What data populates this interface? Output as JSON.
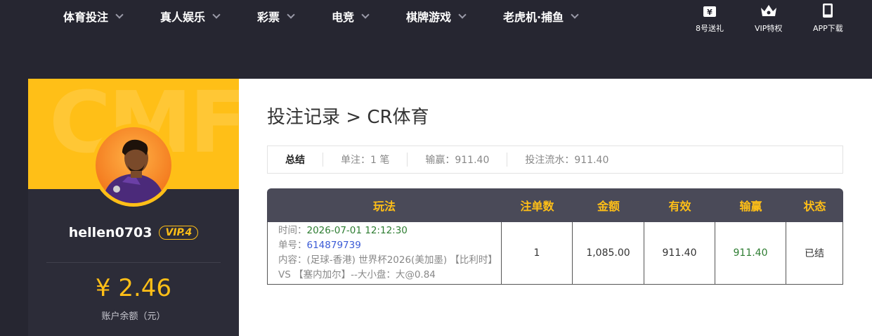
{
  "nav": {
    "items": [
      {
        "label": "体育投注"
      },
      {
        "label": "真人娱乐"
      },
      {
        "label": "彩票"
      },
      {
        "label": "电竞"
      },
      {
        "label": "棋牌游戏"
      },
      {
        "label": "老虎机·捕鱼"
      }
    ],
    "quick_links": [
      {
        "label": "8号送礼",
        "icon": "gift-ticket-icon"
      },
      {
        "label": "VIP特权",
        "icon": "crown-icon"
      },
      {
        "label": "APP下载",
        "icon": "phone-icon"
      }
    ]
  },
  "sidebar": {
    "watermark": "CMF",
    "username": "hellen0703",
    "vip": "VIP.4",
    "balance": "¥ 2.46",
    "balance_label": "账户余额（元）"
  },
  "main": {
    "breadcrumb": "投注记录 > CR体育",
    "summary": {
      "title": "总结",
      "bets": "单注：1 笔",
      "win_loss": "输赢：911.40",
      "turnover": "投注流水：911.40"
    },
    "table": {
      "headers": [
        "玩法",
        "注单数",
        "金额",
        "有效",
        "输赢",
        "状态"
      ],
      "rows": [
        {
          "time_label": "时间：",
          "time": "2026-07-01 12:12:30",
          "order_label": "单号：",
          "order": "614879739",
          "content_label": "内容：",
          "content": "(足球-香港) 世界杯2026(美加墨) 【比利时】 VS 【塞内加尔】--大小盘：大@0.84",
          "count": "1",
          "amount": "1,085.00",
          "valid": "911.40",
          "win_loss": "911.40",
          "status": "已结"
        }
      ]
    }
  },
  "colors": {
    "accent": "#ffbf17",
    "nav_bg": "#262631",
    "header_bg": "#4a4a58",
    "win_green": "#2e7d32"
  }
}
